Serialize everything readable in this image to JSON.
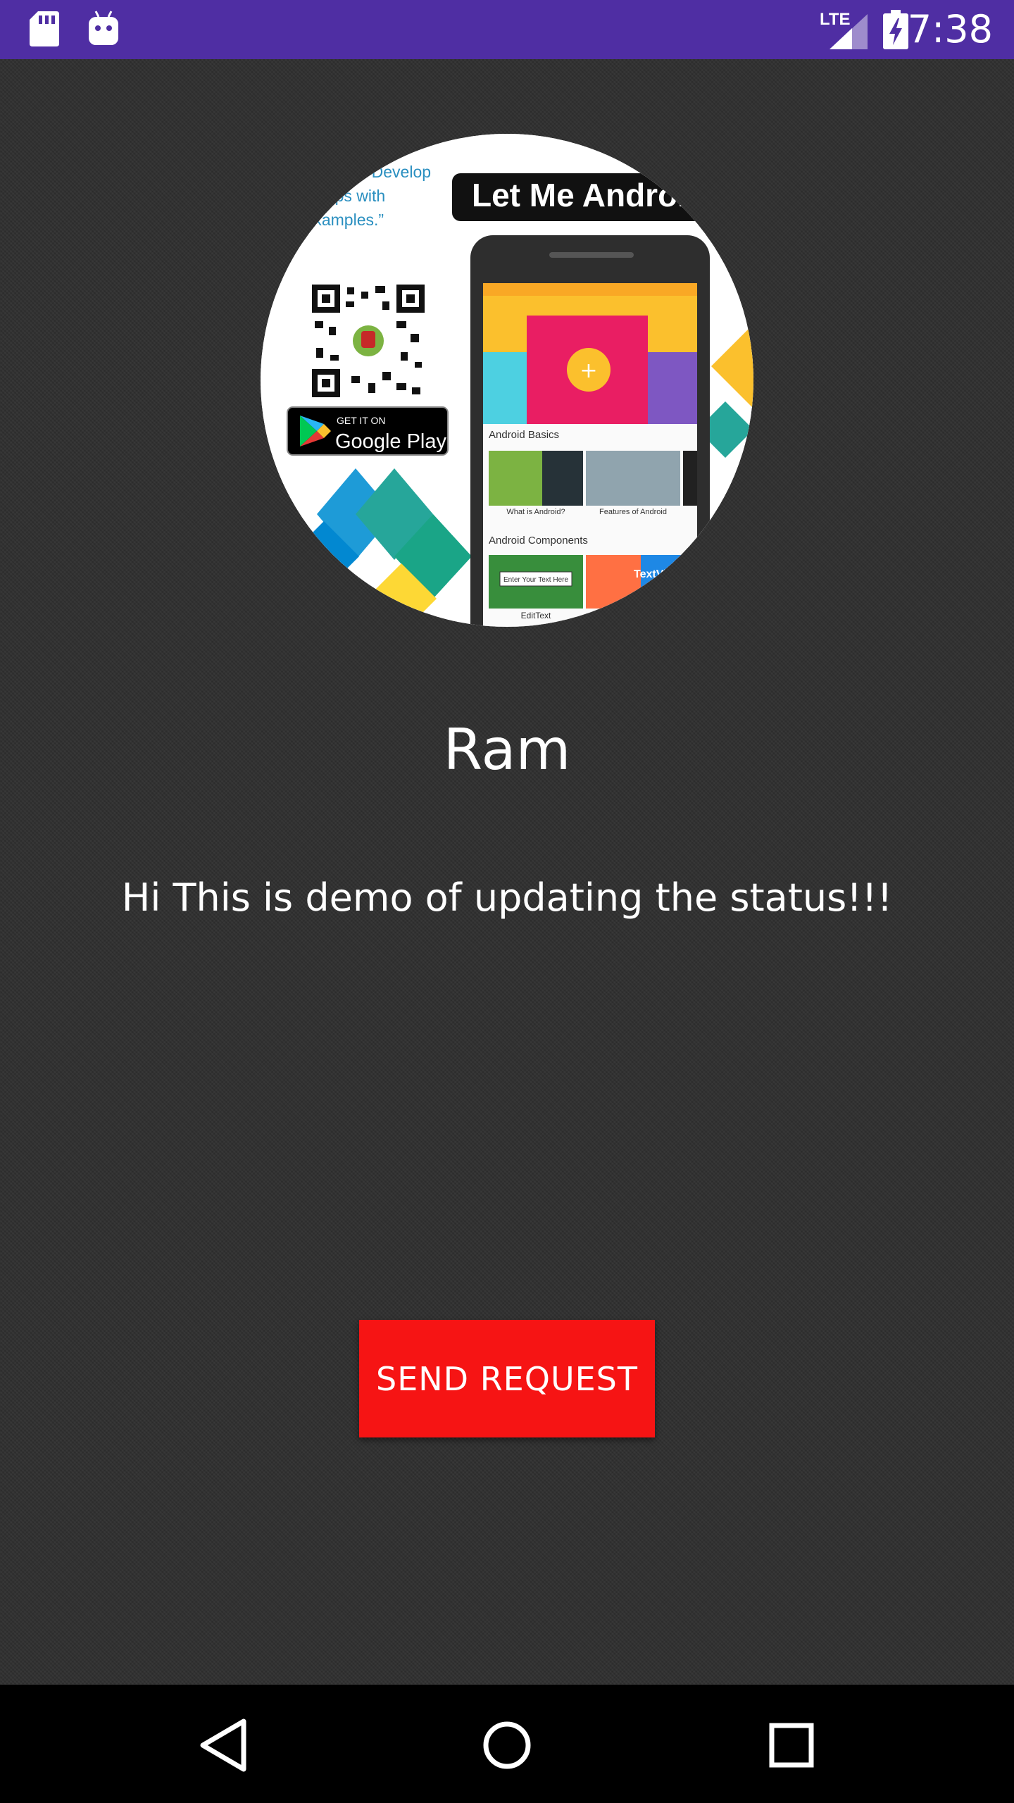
{
  "status_bar": {
    "time": "7:38",
    "network": "LTE",
    "icons": [
      "sd-card-icon",
      "android-icon",
      "signal-icon",
      "battery-charging-icon"
    ]
  },
  "profile": {
    "image": {
      "headline": "Let Me Android",
      "tagline_lines": [
        "“Develop",
        "apps with",
        "Examples.”"
      ],
      "badge_small": "GET IT ON",
      "badge_big": "Google Play",
      "phone_sections": [
        "Android Basics",
        "Android Components"
      ],
      "phone_cards": [
        "What is Android?",
        "Features of Android",
        "EditText"
      ],
      "phone_card_text": [
        "Enter Your Text Here",
        "TextView"
      ]
    },
    "name": "Ram",
    "status": "Hi This is demo of updating the status!!!"
  },
  "actions": {
    "send_request_label": "SEND REQUEST"
  },
  "colors": {
    "status_bar": "#4f2ea3",
    "background": "#2f2f2f",
    "button": "#f61414",
    "nav_bar": "#000000"
  },
  "nav": {
    "icons": [
      "back-icon",
      "home-icon",
      "recents-icon"
    ]
  }
}
